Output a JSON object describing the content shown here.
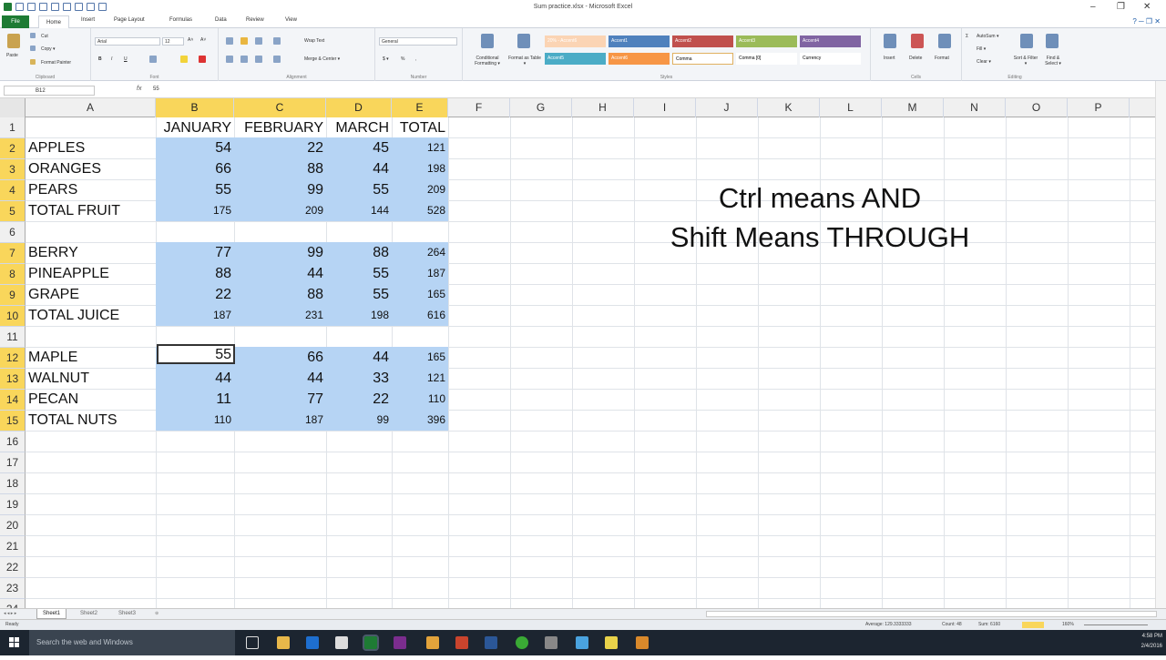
{
  "window": {
    "title": "Sum practice.xlsx - Microsoft Excel",
    "min": "–",
    "max": "❐",
    "close": "✕"
  },
  "tabs": [
    "File",
    "Home",
    "Insert",
    "Page Layout",
    "Formulas",
    "Data",
    "Review",
    "View"
  ],
  "ribbon": {
    "clipboard": {
      "paste": "Paste",
      "cut": "Cut",
      "copy": "Copy ▾",
      "painter": "Format Painter",
      "label": "Clipboard"
    },
    "font": {
      "name": "Arial",
      "size": "12",
      "label": "Font"
    },
    "alignment": {
      "wrap": "Wrap Text",
      "merge": "Merge & Center ▾",
      "label": "Alignment"
    },
    "number": {
      "format": "General",
      "label": "Number"
    },
    "styles": {
      "cond": "Conditional Formatting ▾",
      "table": "Format as Table ▾",
      "label": "Styles",
      "cells": [
        "20% - Accent6",
        "Accent1",
        "Accent2",
        "Accent3",
        "Accent4",
        "Accent5",
        "Accent6",
        "Comma",
        "Comma [0]",
        "Currency"
      ]
    },
    "cells": {
      "insert": "Insert",
      "delete": "Delete",
      "format": "Format",
      "label": "Cells"
    },
    "editing": {
      "autosum": "AutoSum ▾",
      "fill": "Fill ▾",
      "clear": "Clear ▾",
      "sort": "Sort & Filter ▾",
      "find": "Find & Select ▾",
      "label": "Editing"
    }
  },
  "formula_bar": {
    "name_box": "B12",
    "fx": "fx",
    "value": "55"
  },
  "columns": [
    "A",
    "B",
    "C",
    "D",
    "E",
    "F",
    "G",
    "H",
    "I",
    "J",
    "K",
    "L",
    "M",
    "N",
    "O",
    "P"
  ],
  "rows": [
    "1",
    "2",
    "3",
    "4",
    "5",
    "6",
    "7",
    "8",
    "9",
    "10",
    "11",
    "12",
    "13",
    "14",
    "15",
    "16",
    "17",
    "18",
    "19",
    "20",
    "21",
    "22",
    "23",
    "24"
  ],
  "cells": {
    "header": {
      "b": "JANUARY",
      "c": "FEBRUARY",
      "d": "MARCH",
      "e": "TOTAL"
    },
    "r2": {
      "a": "APPLES",
      "b": "54",
      "c": "22",
      "d": "45",
      "e": "121"
    },
    "r3": {
      "a": "ORANGES",
      "b": "66",
      "c": "88",
      "d": "44",
      "e": "198"
    },
    "r4": {
      "a": "PEARS",
      "b": "55",
      "c": "99",
      "d": "55",
      "e": "209"
    },
    "r5": {
      "a": "TOTAL FRUIT",
      "b": "175",
      "c": "209",
      "d": "144",
      "e": "528"
    },
    "r7": {
      "a": "BERRY",
      "b": "77",
      "c": "99",
      "d": "88",
      "e": "264"
    },
    "r8": {
      "a": "PINEAPPLE",
      "b": "88",
      "c": "44",
      "d": "55",
      "e": "187"
    },
    "r9": {
      "a": "GRAPE",
      "b": "22",
      "c": "88",
      "d": "55",
      "e": "165"
    },
    "r10": {
      "a": "TOTAL JUICE",
      "b": "187",
      "c": "231",
      "d": "198",
      "e": "616"
    },
    "r12": {
      "a": "MAPLE",
      "b": "55",
      "c": "66",
      "d": "44",
      "e": "165"
    },
    "r13": {
      "a": "WALNUT",
      "b": "44",
      "c": "44",
      "d": "33",
      "e": "121"
    },
    "r14": {
      "a": "PECAN",
      "b": "11",
      "c": "77",
      "d": "22",
      "e": "110"
    },
    "r15": {
      "a": "TOTAL NUTS",
      "b": "110",
      "c": "187",
      "d": "99",
      "e": "396"
    }
  },
  "overlay": {
    "line1": "Ctrl means AND",
    "line2": "Shift Means THROUGH"
  },
  "sheets": [
    "Sheet1",
    "Sheet2",
    "Sheet3"
  ],
  "status": {
    "ready": "Ready",
    "average": "Average: 129.3333333",
    "count": "Count: 48",
    "sum": "Sum: 6160",
    "zoom": "160%"
  },
  "taskbar": {
    "search": "Search the web and Windows",
    "time": "4:58 PM",
    "date": "2/4/2016"
  },
  "colors": {
    "selection": "#b6d4f4",
    "header_highlight": "#f9d65b",
    "file_tab": "#1e7b34"
  }
}
